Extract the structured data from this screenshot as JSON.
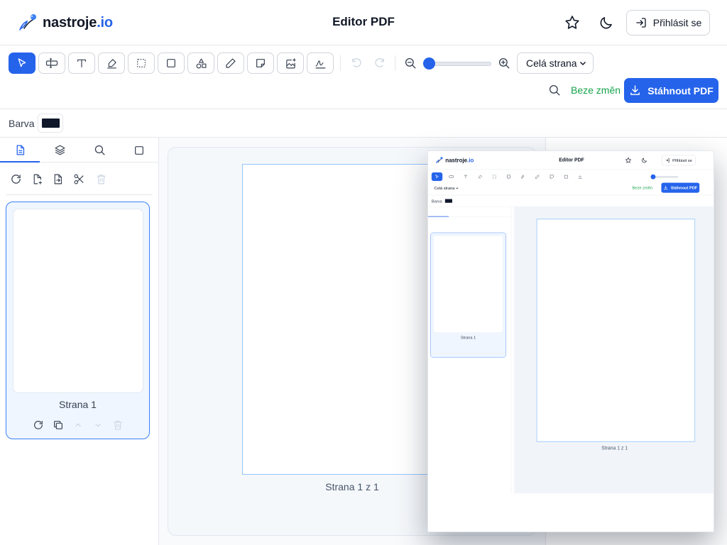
{
  "header": {
    "logo_text": "nastroje",
    "logo_suffix": ".io",
    "title": "Editor PDF",
    "login_label": "Přihlásit se"
  },
  "toolbar": {
    "tools": [
      {
        "name": "select-tool",
        "icon": "cursor-icon",
        "active": true
      },
      {
        "name": "text-field-tool",
        "icon": "text-field-icon"
      },
      {
        "name": "text-tool",
        "icon": "text-icon"
      },
      {
        "name": "highlight-tool",
        "icon": "highlighter-icon"
      },
      {
        "name": "selection-rect-tool",
        "icon": "dashed-rect-icon"
      },
      {
        "name": "rectangle-tool",
        "icon": "square-icon"
      },
      {
        "name": "shapes-tool",
        "icon": "shapes-icon"
      },
      {
        "name": "pencil-tool",
        "icon": "pencil-icon"
      },
      {
        "name": "note-tool",
        "icon": "sticky-note-icon"
      },
      {
        "name": "image-tool",
        "icon": "image-plus-icon"
      },
      {
        "name": "signature-tool",
        "icon": "signature-icon"
      }
    ],
    "zoom_value": 10,
    "zoom_mode": "Celá strana",
    "status": "Beze změn",
    "download_label": "Stáhnout PDF"
  },
  "colorbar": {
    "label": "Barva",
    "color": "#0f172a"
  },
  "sidebar": {
    "tabs": [
      "pages-tab",
      "layers-tab",
      "search-tab",
      "shapes-tab"
    ],
    "actions": [
      "rotate-icon",
      "add-page-icon",
      "import-page-icon",
      "scissors-icon",
      "trash-icon"
    ],
    "thumbnail_label": "Strana 1"
  },
  "canvas": {
    "page_count": "Strana 1 z 1"
  },
  "colors": {
    "accent": "#2563eb",
    "success": "#16a34a"
  }
}
